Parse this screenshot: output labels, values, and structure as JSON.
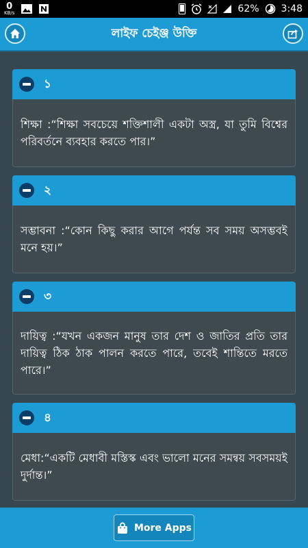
{
  "status_bar": {
    "net_speed_value": "0",
    "net_speed_unit": "KB/s",
    "battery": "62%",
    "time": "3:48"
  },
  "header": {
    "title": "লাইফ চেইঞ্জ উক্তি",
    "home_icon": "home-icon",
    "share_icon": "share-icon"
  },
  "quotes": [
    {
      "number": "১",
      "text": "শিক্ষা :“শিক্ষা সবচেয়ে শক্তিশালী একটা অস্ত্র, যা তুমি বিশ্বের পরিবর্তনে ব্যবহার করতে পার।”"
    },
    {
      "number": "২",
      "text": "সম্ভাবনা :“কোন কিছু করার আগে পর্যন্ত সব সময় অসম্ভবই মনে হয়।”"
    },
    {
      "number": "৩",
      "text": "দায়িত্ব :“যখন একজন মানুষ তার দেশ ও জাতির প্রতি তার দায়িত্ব ঠিক ঠাক পালন করতে পারে, তবেই শান্তিতে মরতে পারে।”"
    },
    {
      "number": "৪",
      "text": "মেধা:“একটি মেধাবী মস্তিস্ক এবং ভালো মনের সমন্বয় সবসময়ই দুর্দান্ত।”"
    }
  ],
  "footer": {
    "more_apps_label": "More Apps",
    "bag_icon": "shopping-bag-icon"
  },
  "colors": {
    "primary": "#1c9bd5",
    "background": "#37474f",
    "card_body": "#3e4a50",
    "minus_circle": "#0b3d66"
  }
}
